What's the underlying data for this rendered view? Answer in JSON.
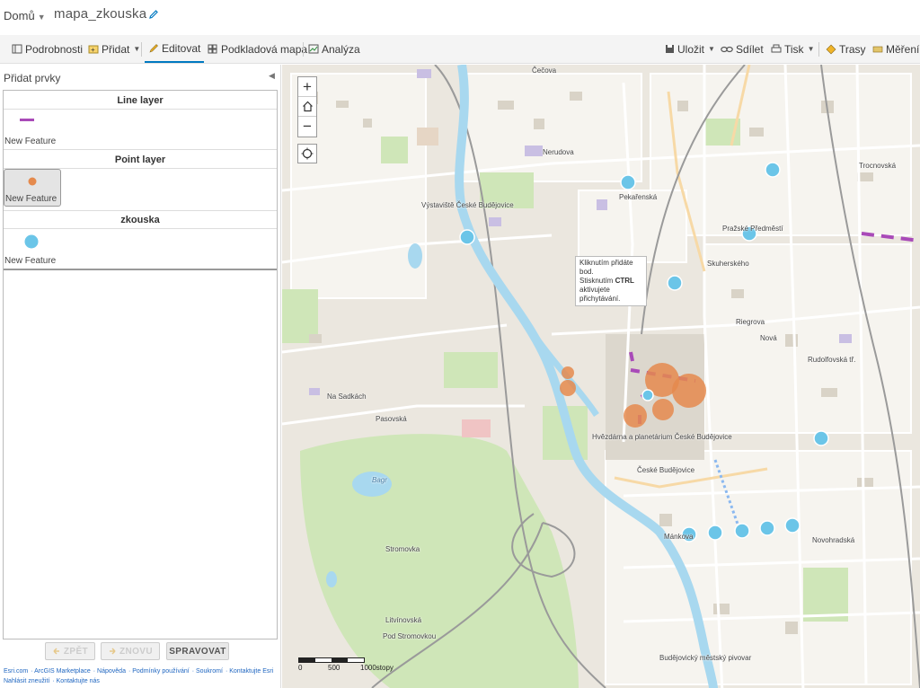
{
  "topbar": {
    "home_label": "Domů",
    "map_title": "mapa_zkouska"
  },
  "toolbar": {
    "details": "Podrobnosti",
    "add": "Přidat",
    "edit": "Editovat",
    "basemap": "Podkladová mapa",
    "analysis": "Analýza",
    "save": "Uložit",
    "share": "Sdílet",
    "print": "Tisk",
    "routes": "Trasy",
    "measure": "Měření"
  },
  "panel": {
    "title": "Přidat prvky",
    "layers": [
      {
        "name": "Line layer",
        "feature_label": "New Feature",
        "symbol": "line",
        "color": "#a94ab8"
      },
      {
        "name": "Point layer",
        "feature_label": "New Feature",
        "symbol": "point",
        "color": "#e58a4d",
        "selected": true
      },
      {
        "name": "zkouska",
        "feature_label": "New Feature",
        "symbol": "point",
        "color": "#6bc5e8"
      }
    ],
    "undo": "ZPĚT",
    "redo": "ZNOVU",
    "manage": "SPRAVOVAT"
  },
  "footer": {
    "links": [
      "Esri.com",
      "ArcGIS Marketplace",
      "Nápověda",
      "Podmínky používání",
      "Soukromí",
      "Kontaktujte Esri",
      "Nahlásit zneužití",
      "Kontaktujte nás"
    ]
  },
  "map": {
    "tooltip": {
      "line1": "Kliknutím přidáte",
      "line2": "bod.",
      "line3": "Stisknutím",
      "ctrl": "CTRL",
      "line4": "aktivujete",
      "line5": "přichytávání."
    },
    "labels": {
      "vystaviste": "Výstaviště České Budějovice",
      "prazske": "Pražské Předměstí",
      "hvezdarna": "Hvězdárna a planetárium České Budějovice",
      "ceske": "České Budějovice",
      "pod": "Pod Stromovkou",
      "budejovicky": "Budějovický městský pivovar",
      "bagr": "Bagr",
      "cecova": "Čečova",
      "nerudova": "Nerudova",
      "pekarenska": "Pekařenská",
      "novohradska": "Novohradská",
      "rudolfovska": "Rudolfovská tř.",
      "pasovska": "Pasovská",
      "na_sadkach": "Na Sadkách",
      "stromovka": "Stromovka",
      "litvinovska": "Litvínovská",
      "mankova": "Mánkova",
      "riegrova": "Riegrova",
      "nova": "Nová",
      "skuherskeho": "Skuherského",
      "trocnovska": "Trocnovská"
    },
    "scale": {
      "s0": "0",
      "s1": "500",
      "s2": "1000stopy"
    },
    "colors": {
      "point_layer": "#e58a4d",
      "zkouska": "#6bc5e8",
      "line_layer": "#a94ab8",
      "river": "#a8d8ef",
      "green": "#cfe6b8"
    }
  }
}
